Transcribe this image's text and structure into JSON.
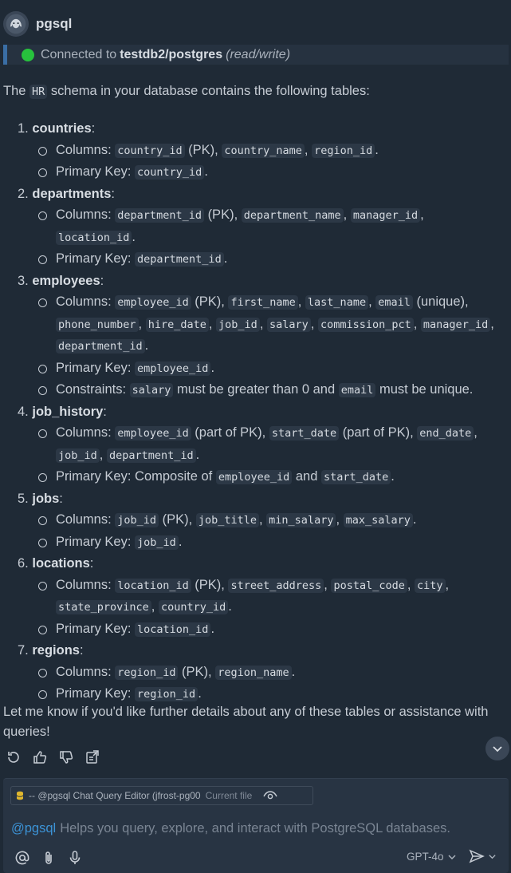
{
  "header": {
    "bot_name": "pgsql",
    "avatar_icon": "elephant-icon"
  },
  "connection": {
    "prefix": "Connected to",
    "target": "testdb2/postgres",
    "mode": "(read/write)",
    "status_color": "#27c23d"
  },
  "message": {
    "intro_before": "The",
    "intro_code": "HR",
    "intro_after": "schema in your database contains the following tables:",
    "tables": [
      {
        "number": "1.",
        "name": "countries"
      },
      {
        "number": "2.",
        "name": "departments"
      },
      {
        "number": "3.",
        "name": "employees"
      },
      {
        "number": "4.",
        "name": "job_history"
      },
      {
        "number": "5.",
        "name": "jobs"
      },
      {
        "number": "6.",
        "name": "locations"
      },
      {
        "number": "7.",
        "name": "regions"
      }
    ],
    "labels": {
      "columns": "Columns:",
      "primary_key": "Primary Key:",
      "constraints": "Constraints:",
      "pk": "(PK)",
      "unique": "(unique)",
      "part_of_pk": "(part of PK)",
      "composite_of": "Composite of",
      "and": "and",
      "must_be_gt0_and": "must be greater than 0 and",
      "must_be_unique": "must be unique."
    },
    "cols": {
      "country_id": "country_id",
      "country_name": "country_name",
      "region_id": "region_id",
      "department_id": "department_id",
      "department_name": "department_name",
      "manager_id": "manager_id",
      "location_id": "location_id",
      "employee_id": "employee_id",
      "first_name": "first_name",
      "last_name": "last_name",
      "email": "email",
      "phone_number": "phone_number",
      "hire_date": "hire_date",
      "job_id": "job_id",
      "salary": "salary",
      "commission_pct": "commission_pct",
      "start_date": "start_date",
      "end_date": "end_date",
      "job_title": "job_title",
      "min_salary": "min_salary",
      "max_salary": "max_salary",
      "street_address": "street_address",
      "postal_code": "postal_code",
      "city": "city",
      "state_province": "state_province",
      "region_name": "region_name"
    },
    "outro": "Let me know if you'd like further details about any of these tables or assistance with queries!"
  },
  "actions": [
    {
      "name": "retry-icon"
    },
    {
      "name": "thumbs-up-icon"
    },
    {
      "name": "thumbs-down-icon"
    },
    {
      "name": "insert-into-editor-icon"
    }
  ],
  "scroll_button_icon": "chevron-down-icon",
  "composer": {
    "context_chip_label": "-- @pgsql Chat Query Editor (jfrost-pg00",
    "context_chip_tag": "Current file",
    "mention": "@pgsql",
    "placeholder": "Helps you query, explore, and interact with PostgreSQL databases.",
    "model": "GPT-4o",
    "mention_color": "#3c93d6"
  }
}
